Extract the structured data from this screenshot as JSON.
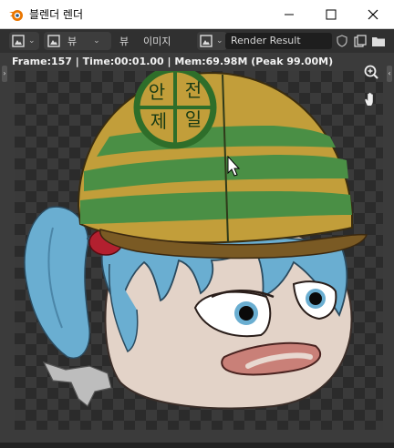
{
  "window": {
    "title": "블렌더 렌더",
    "controls": {
      "minimize_icon": "minimize-icon",
      "maximize_icon": "maximize-icon",
      "close_icon": "close-icon"
    }
  },
  "header": {
    "editor_type_icon": "image-editor-icon",
    "mode_label": "뷰",
    "menu": [
      "뷰",
      "이미지"
    ],
    "image_field_value": "Render Result",
    "icons": [
      "image-browse-icon",
      "fake-user-shield-icon",
      "new-image-icon",
      "open-folder-icon"
    ]
  },
  "viewport": {
    "stats": "Frame:157 | Time:00:01.00 | Mem:69.98M (Peak 99.00M)",
    "tools": [
      "zoom-icon",
      "hand-pan-icon"
    ],
    "helmet_text": [
      "안",
      "전",
      "제",
      "일"
    ]
  },
  "colors": {
    "header_bg": "#303030",
    "viewport_bg": "#3b3b3b",
    "helmet_yellow": "#c29e3a",
    "helmet_green": "#4a8f45",
    "hair_blue": "#6aaed1"
  }
}
